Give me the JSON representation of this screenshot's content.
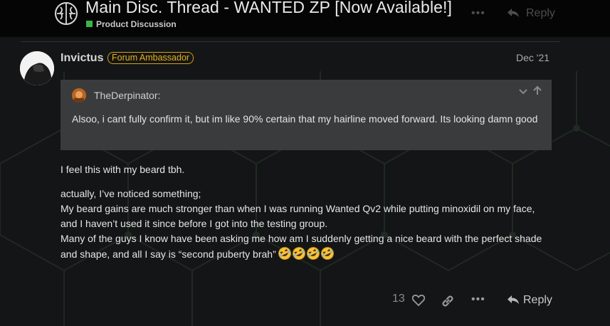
{
  "topic": {
    "title": "Main Disc. Thread - WANTED ZP [Now Available!]",
    "category": "Product Discussion",
    "more_label": "•••",
    "reply_label": "Reply"
  },
  "post": {
    "username": "Invictus",
    "badge": "Forum Ambassador",
    "date": "Dec '21",
    "quote": {
      "username": "TheDerpinator:",
      "text": "Alsoo, i cant fully confirm it, but im like 90% certain that my hairline moved forward. Its looking damn good"
    },
    "body": {
      "line1": "I feel this with my beard tbh.",
      "line2": "actually, I’ve noticed something;",
      "line3": "My beard gains are much stronger than when I was running Wanted Qv2 while putting minoxidil on my face, and I haven’t used it since before I got into the testing group.",
      "line4": "Many of the guys I know have been asking me how am I suddenly getting a nice beard with the perfect shade and shape, and all I say is “second puberty brah”"
    },
    "emoji_name": "rolling-on-the-floor-laughing",
    "emoji_count": 4,
    "likes": "13",
    "more_label": "•••",
    "reply_label": "Reply"
  },
  "colors": {
    "badge": "#e5b21a",
    "category": "#3ab54a",
    "background": "#141516",
    "quote_bg": "#3a3b3c"
  }
}
